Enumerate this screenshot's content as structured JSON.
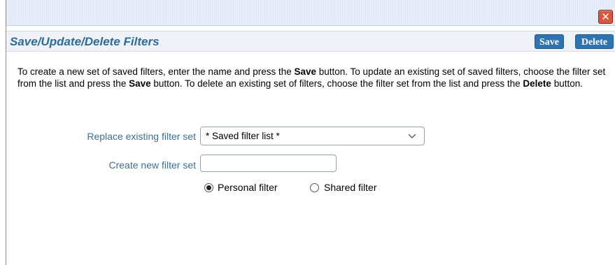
{
  "titlebar": {
    "close_glyph": "✕"
  },
  "header": {
    "title": "Save/Update/Delete Filters",
    "save_label": "Save",
    "delete_label": "Delete"
  },
  "instructions": {
    "p1": "To create a new set of saved filters, enter the name and press the ",
    "b1": "Save",
    "p2": " button. To update an existing set of saved filters, choose the filter set from the list and press the ",
    "b2": "Save",
    "p3": " button. To delete an existing set of filters, choose the filter set from the list and press the ",
    "b3": "Delete",
    "p4": " button."
  },
  "form": {
    "replace_label": "Replace existing filter set",
    "replace_selected": "* Saved filter list *",
    "create_label": "Create new filter set",
    "create_value": "",
    "radio_personal_label": "Personal filter",
    "radio_shared_label": "Shared filter",
    "selected_scope": "personal"
  },
  "colors": {
    "accent": "#2f74b0",
    "label": "#3a6f98",
    "title": "#2d6b9a",
    "close": "#d9573e"
  },
  "icons": {
    "close": "close-icon",
    "dropdown": "chevron-down-icon"
  }
}
